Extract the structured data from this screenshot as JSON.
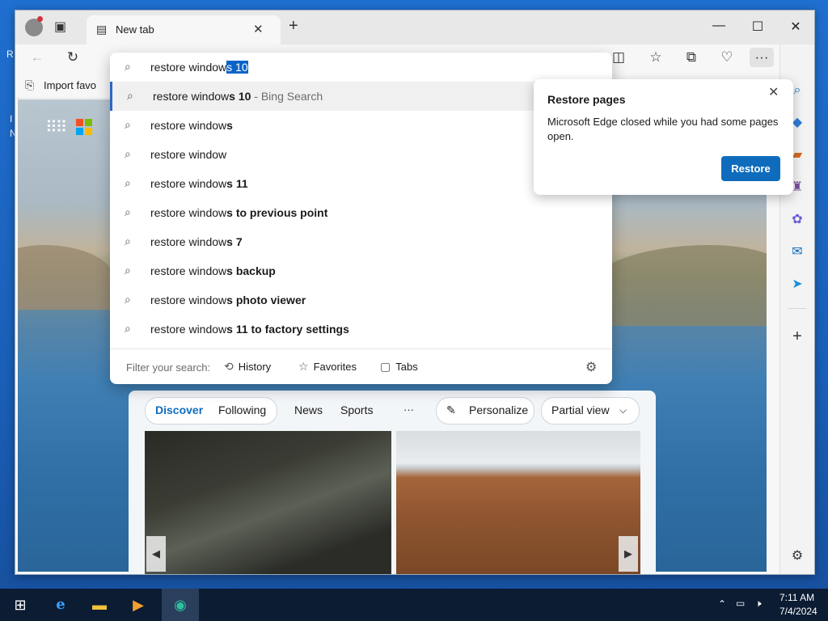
{
  "desktop": {
    "edge_letters": [
      "R",
      "I",
      "N"
    ]
  },
  "browser": {
    "tab": {
      "label": "New tab"
    },
    "window_controls": {
      "minimize": "—",
      "maximize": "☐",
      "close": "✕"
    },
    "favorites_bar": {
      "import_label": "Import favo"
    },
    "omnibox": {
      "typed_text": "restore window",
      "selected_completion": "s 10",
      "suggestions": [
        {
          "prefix": "restore window",
          "bold": "s 10",
          "source": " - Bing Search"
        },
        {
          "prefix": "restore window",
          "bold": "s",
          "source": ""
        },
        {
          "prefix": "restore window",
          "bold": "",
          "source": ""
        },
        {
          "prefix": "restore window",
          "bold": "s 11",
          "source": ""
        },
        {
          "prefix": "restore window",
          "bold": "s to previous point",
          "source": ""
        },
        {
          "prefix": "restore window",
          "bold": "s 7",
          "source": ""
        },
        {
          "prefix": "restore window",
          "bold": "s backup",
          "source": ""
        },
        {
          "prefix": "restore window",
          "bold": "s photo viewer",
          "source": ""
        },
        {
          "prefix": "restore window",
          "bold": "s 11 to factory settings",
          "source": ""
        }
      ],
      "filter": {
        "label": "Filter your search:",
        "history": "History",
        "favorites": "Favorites",
        "tabs": "Tabs"
      }
    },
    "restore_popup": {
      "title": "Restore pages",
      "body": "Microsoft Edge closed while you had some pages open.",
      "button": "Restore"
    },
    "feed": {
      "tabs": {
        "discover": "Discover",
        "following": "Following",
        "news": "News",
        "sports": "Sports",
        "more": "···"
      },
      "personalize": "Personalize",
      "view": "Partial view"
    }
  },
  "taskbar": {
    "time": "7:11 AM",
    "date": "7/4/2024"
  },
  "colors": {
    "accent": "#0f6cbd",
    "selection": "#0a64c8",
    "taskbar": "#0b1c33"
  }
}
